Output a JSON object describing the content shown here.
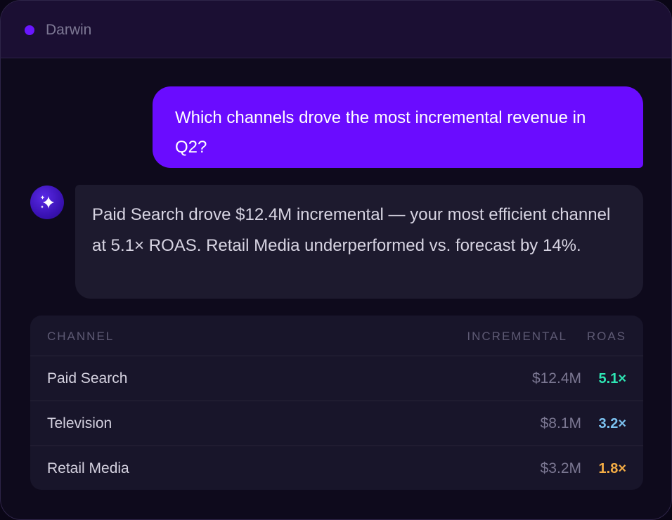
{
  "app": {
    "title": "Darwin",
    "status_color": "#6a16ff"
  },
  "chat": {
    "user_message": "Which channels drove the most incremental revenue in Q2?",
    "assistant_message": "Paid Search drove $12.4M incremental — your most efficient channel at 5.1× ROAS. Retail Media underperformed vs. forecast by 14%.",
    "assistant_avatar_icon": "sparkle-icon",
    "user_bubble_color": "#6a0cff"
  },
  "table": {
    "headers": {
      "channel": "CHANNEL",
      "incremental": "INCREMENTAL",
      "roas": "ROAS"
    },
    "rows": [
      {
        "channel": "Paid Search",
        "incremental": "$12.4M",
        "roas": "5.1×",
        "roas_color": "#2ee6b4"
      },
      {
        "channel": "Television",
        "incremental": "$8.1M",
        "roas": "3.2×",
        "roas_color": "#7cc2f0"
      },
      {
        "channel": "Retail Media",
        "incremental": "$3.2M",
        "roas": "1.8×",
        "roas_color": "#f5ad45"
      }
    ]
  }
}
